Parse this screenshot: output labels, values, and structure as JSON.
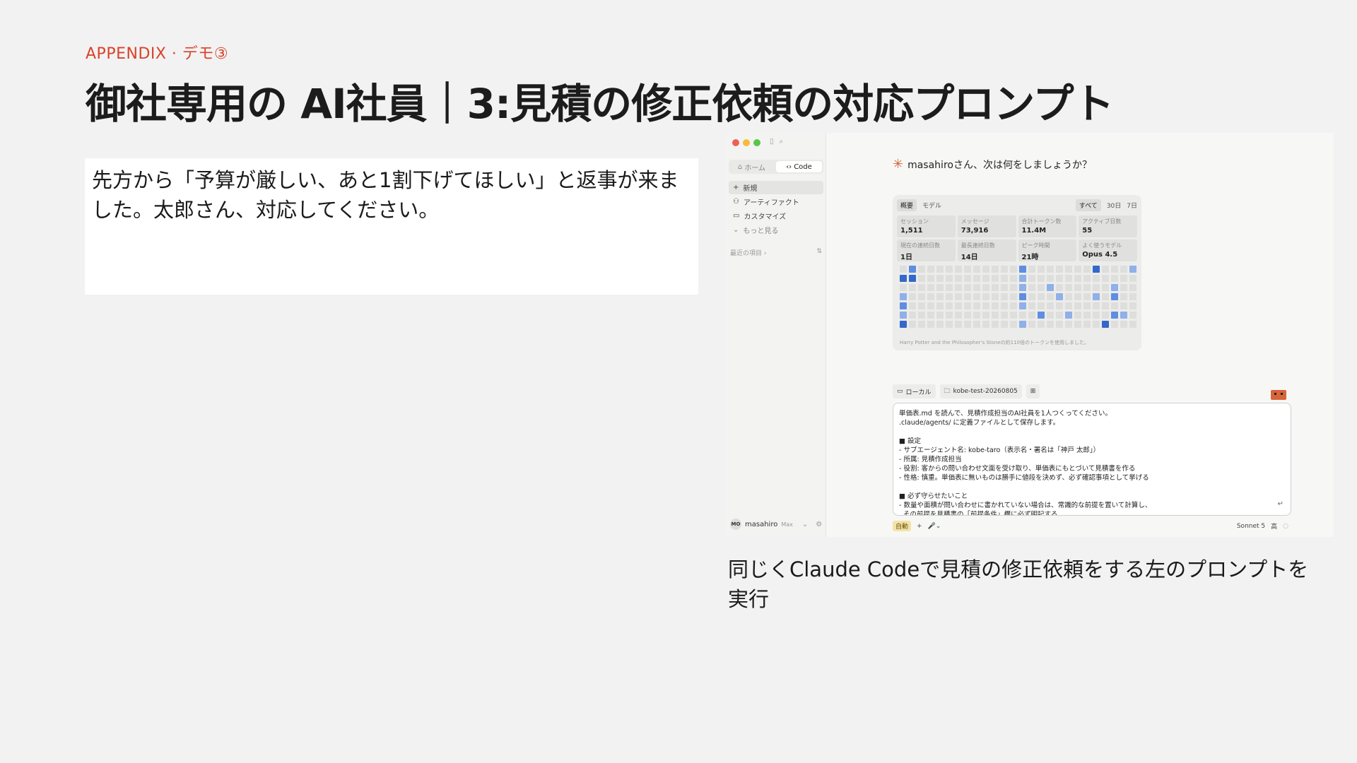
{
  "slide": {
    "label": "APPENDIX · デモ③",
    "title": "御社専用の AI社員｜3:見積の修正依頼の対応プロンプト",
    "prompt_text": "先方から「予算が厳しい、あと1割下げてほしい」と返事が来ました。太郎さん、対応してください。",
    "caption": "同じくClaude Codeで見積の修正依頼をする左のプロンプトを実行"
  },
  "screenshot": {
    "window_dots": [
      "#ee5f57",
      "#f6bd3b",
      "#5ac548"
    ],
    "sidebar": {
      "tabs": [
        {
          "label": "ホーム",
          "icon": "home-icon"
        },
        {
          "label": "Code",
          "icon": "code-icon"
        }
      ],
      "items": [
        {
          "label": "新規",
          "icon": "plus-icon"
        },
        {
          "label": "アーティファクト",
          "icon": "artifact-icon"
        },
        {
          "label": "カスタマイズ",
          "icon": "briefcase-icon"
        },
        {
          "label": "もっと見る",
          "icon": "chevron-down-icon"
        }
      ],
      "recent_label": "最近の項目 ›",
      "user": {
        "initials": "MO",
        "name": "masahiro",
        "plan": "Max"
      }
    },
    "greeting": "masahiroさん、次は何をしましょうか？",
    "stats": {
      "tabs_left": [
        "概要",
        "モデル"
      ],
      "tabs_right": [
        "すべて",
        "30日",
        "7日"
      ],
      "cards": [
        {
          "key": "セッション",
          "value": "1,511"
        },
        {
          "key": "メッセージ",
          "value": "73,916"
        },
        {
          "key": "合計トークン数",
          "value": "11.4M"
        },
        {
          "key": "アクティブ日数",
          "value": "55"
        },
        {
          "key": "現在の連続日数",
          "value": "1日"
        },
        {
          "key": "最長連続日数",
          "value": "14日"
        },
        {
          "key": "ピーク時間",
          "value": "21時"
        },
        {
          "key": "よく使うモデル",
          "value": "Opus 4.5"
        }
      ],
      "footer": "Harry Potter and the Philosopher's Stoneの約110倍のトークンを使用しました。"
    },
    "chips": [
      "ローカル",
      "kobe-test-20260805"
    ],
    "input_text": "単価表.md を読んで、見積作成担当のAI社員を1人つくってください。\n.claude/agents/ に定義ファイルとして保存します。\n\n■ 設定\n- サブエージェント名: kobe-taro（表示名・署名は「神戸 太郎」）\n- 所属: 見積作成担当\n- 役割: 客からの問い合わせ文面を受け取り、単価表にもとづいて見積書を作る\n- 性格: 慎重。単価表に無いものは勝手に値段を決めず、必ず確認事項として挙げる\n\n■ 必ず守らせたいこと\n- 数量や面積が問い合わせに書かれていない場合は、常識的な前提を置いて計算し、\n  その前提を見積書の「前提条件」欄に必ず明記する",
    "bottom_left": [
      "自動",
      "+",
      "🎤"
    ],
    "model": "Sonnet 5",
    "effort": "高"
  }
}
